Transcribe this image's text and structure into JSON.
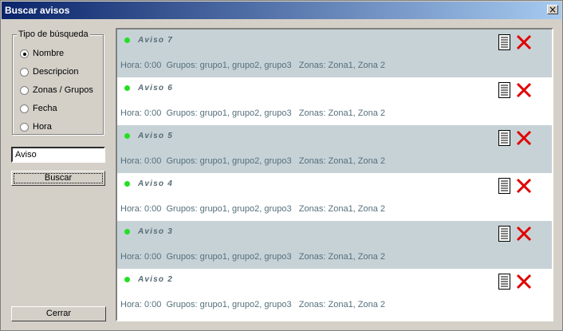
{
  "window": {
    "title": "Buscar avisos",
    "close_glyph": "×"
  },
  "search_type": {
    "legend": "Tipo de búsqueda",
    "options": [
      {
        "label": "Nombre",
        "checked": true
      },
      {
        "label": "Descripcion",
        "checked": false
      },
      {
        "label": "Zonas / Grupos",
        "checked": false
      },
      {
        "label": "Fecha",
        "checked": false
      },
      {
        "label": "Hora",
        "checked": false
      }
    ]
  },
  "search": {
    "value": "Aviso",
    "button_label": "Buscar"
  },
  "close_button_label": "Cerrar",
  "items": [
    {
      "name": "Aviso 7",
      "details": "Hora: 0:00  Grupos: grupo1, grupo2, grupo3   Zonas: Zona1, Zona 2"
    },
    {
      "name": "Aviso 6",
      "details": "Hora: 0:00  Grupos: grupo1, grupo2, grupo3   Zonas: Zona1, Zona 2"
    },
    {
      "name": "Aviso 5",
      "details": "Hora: 0:00  Grupos: grupo1, grupo2, grupo3   Zonas: Zona1, Zona 2"
    },
    {
      "name": "Aviso 4",
      "details": "Hora: 0:00  Grupos: grupo1, grupo2, grupo3   Zonas: Zona1, Zona 2"
    },
    {
      "name": "Aviso 3",
      "details": "Hora: 0:00  Grupos: grupo1, grupo2, grupo3   Zonas: Zona1, Zona 2"
    },
    {
      "name": "Aviso 2",
      "details": "Hora: 0:00  Grupos: grupo1, grupo2, grupo3   Zonas: Zona1, Zona 2"
    }
  ],
  "colors": {
    "alt_row": "#c7d2d6",
    "status_dot": "#22e022",
    "delete": "#e00000",
    "text": "#55707d"
  },
  "icons": {
    "item_status": "green-dot-icon",
    "item_doc": "document-icon",
    "item_delete": "delete-x-icon"
  }
}
